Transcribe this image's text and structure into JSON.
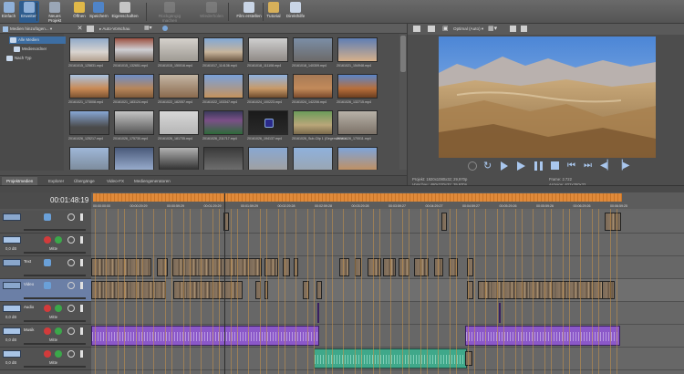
{
  "toolbar": {
    "buttons": [
      {
        "label": "Einfach",
        "icon": "grid-icon"
      },
      {
        "label": "Erweitert",
        "icon": "grid-icon"
      },
      {
        "label": "Neues Projekt",
        "icon": "new-project-icon"
      },
      {
        "label": "Öffnen",
        "icon": "folder-icon"
      },
      {
        "label": "Speichern",
        "icon": "save-icon"
      },
      {
        "label": "Eigenschaften",
        "icon": "properties-icon"
      },
      {
        "label": "Rückgängig machen",
        "icon": "undo-icon"
      },
      {
        "label": "Wiederholen",
        "icon": "redo-icon"
      },
      {
        "label": "Film erstellen",
        "icon": "film-icon"
      },
      {
        "label": "Tutorial",
        "icon": "tutorial-icon"
      },
      {
        "label": "Direkthilfe",
        "icon": "help-icon"
      }
    ]
  },
  "media": {
    "import_label": "Medien hinzufügen...",
    "auto_preview_label": "Auto-Vorschau",
    "tree": [
      {
        "label": "Alle Medien"
      },
      {
        "label": "Medienordner"
      },
      {
        "label": "Nach Typ"
      }
    ],
    "thumbs": [
      {
        "caption": "20161015_125831.mp4"
      },
      {
        "caption": "20161015_132651.mp4"
      },
      {
        "caption": "20161015_150016.mp4"
      },
      {
        "caption": "20161017_114136.mp4"
      },
      {
        "caption": "20161018_111108.mp4"
      },
      {
        "caption": "20161018_140309.mp4"
      },
      {
        "caption": "20161021_154948.mp4"
      },
      {
        "caption": "20161021_173008.mp4"
      },
      {
        "caption": "20161021_183124.mp4"
      },
      {
        "caption": "20161022_182057.mp4"
      },
      {
        "caption": "20161022_103347.mp4"
      },
      {
        "caption": "20161024_100223.mp4"
      },
      {
        "caption": "20161024_142206.mp4"
      },
      {
        "caption": "20161026_132715.mp4"
      },
      {
        "caption": "20161026_125217.mp4"
      },
      {
        "caption": "20161026_175730.mp4"
      },
      {
        "caption": "20161026_181735.mp4"
      },
      {
        "caption": "20161026_211717.mp4"
      },
      {
        "caption": "20161026_194137.mp4"
      },
      {
        "caption": "20161026_Sub-Clip 1 (Gegenwerte.a..."
      },
      {
        "caption": "20161026_170011.mp4"
      },
      {
        "caption": "20161026_170925.mp4"
      },
      {
        "caption": ""
      },
      {
        "caption": ""
      },
      {
        "caption": ""
      },
      {
        "caption": ""
      },
      {
        "caption": ""
      },
      {
        "caption": ""
      },
      {
        "caption": ""
      }
    ]
  },
  "tabs": [
    "Projektmedien",
    "Explorer",
    "Übergänge",
    "Video-FX",
    "Mediengeneratoren"
  ],
  "preview": {
    "mode_label": "Optimal (Auto)",
    "info": {
      "projekt_label": "Projekt:",
      "projekt_value": "1920x1080x32; 29,970p",
      "vorschau_label": "Vorschau:",
      "vorschau_value": "480x270x32; 29,970p",
      "frame_label": "Frame:",
      "frame_value": "2.722",
      "anzeige_label": "Anzeige:",
      "anzeige_value": "622x350x32"
    }
  },
  "timeline": {
    "timecode": "00:01:48:19",
    "ruler_ticks": [
      "00:00:00:00",
      "00:00:29:29",
      "00:00:59:29",
      "00:01:29:29",
      "00:01:59:29",
      "00:02:29:28",
      "00:02:59:28",
      "00:03:29:28",
      "00:03:59:27",
      "00:04:29:27",
      "00:04:59:27",
      "00:05:29:26",
      "00:05:59:26",
      "00:06:29:26",
      "00:06:59:25"
    ],
    "tracks": [
      {
        "label": "",
        "level": "",
        "mode": "",
        "kind": "video"
      },
      {
        "label": "",
        "level": "0,0 dB",
        "mode": "Mitte",
        "kind": "audio"
      },
      {
        "label": "Text",
        "level": "",
        "mode": "",
        "kind": "video"
      },
      {
        "label": "Video",
        "level": "",
        "mode": "",
        "kind": "video"
      },
      {
        "label": "Audio",
        "level": "0,0 dB",
        "mode": "Mitte",
        "kind": "audio"
      },
      {
        "label": "Musik",
        "level": "0,0 dB",
        "mode": "Mitte",
        "kind": "audio"
      },
      {
        "label": "",
        "level": "0,0 dB",
        "mode": "Mitte",
        "kind": "audio"
      }
    ]
  },
  "colors": {
    "accent": "#3d6ea3",
    "timeline_orange": "#e08a3a",
    "audio_purple": "#8b58c9",
    "audio_teal": "#3fa88a"
  }
}
